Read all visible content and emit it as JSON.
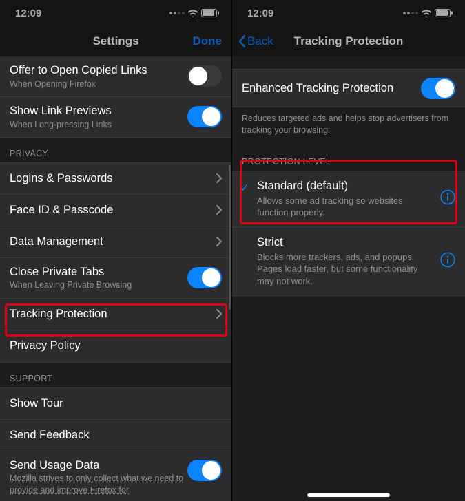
{
  "status": {
    "time": "12:09"
  },
  "left": {
    "nav": {
      "title": "Settings",
      "done": "Done"
    },
    "rows": {
      "copied": {
        "title": "Offer to Open Copied Links",
        "sub": "When Opening Firefox"
      },
      "previews": {
        "title": "Show Link Previews",
        "sub": "When Long-pressing Links"
      }
    },
    "sections": {
      "privacy": "Privacy",
      "support": "Support"
    },
    "privacy_rows": {
      "logins": "Logins & Passwords",
      "faceid": "Face ID & Passcode",
      "data": "Data Management",
      "close_tabs": {
        "title": "Close Private Tabs",
        "sub": "When Leaving Private Browsing"
      },
      "tracking": "Tracking Protection",
      "policy": "Privacy Policy"
    },
    "support_rows": {
      "tour": "Show Tour",
      "feedback": "Send Feedback",
      "usage": {
        "title": "Send Usage Data",
        "sub": "Mozilla strives to only collect what we need to provide and improve Firefox for"
      }
    }
  },
  "right": {
    "nav": {
      "back": "Back",
      "title": "Tracking Protection"
    },
    "etp": {
      "title": "Enhanced Tracking Protection",
      "desc": "Reduces targeted ads and helps stop advertisers from tracking your browsing."
    },
    "section_level": "Protection Level",
    "levels": {
      "standard": {
        "title": "Standard (default)",
        "sub": "Allows some ad tracking so websites function properly."
      },
      "strict": {
        "title": "Strict",
        "sub": "Blocks more trackers, ads, and popups. Pages load faster, but some functionality may not work."
      }
    }
  }
}
